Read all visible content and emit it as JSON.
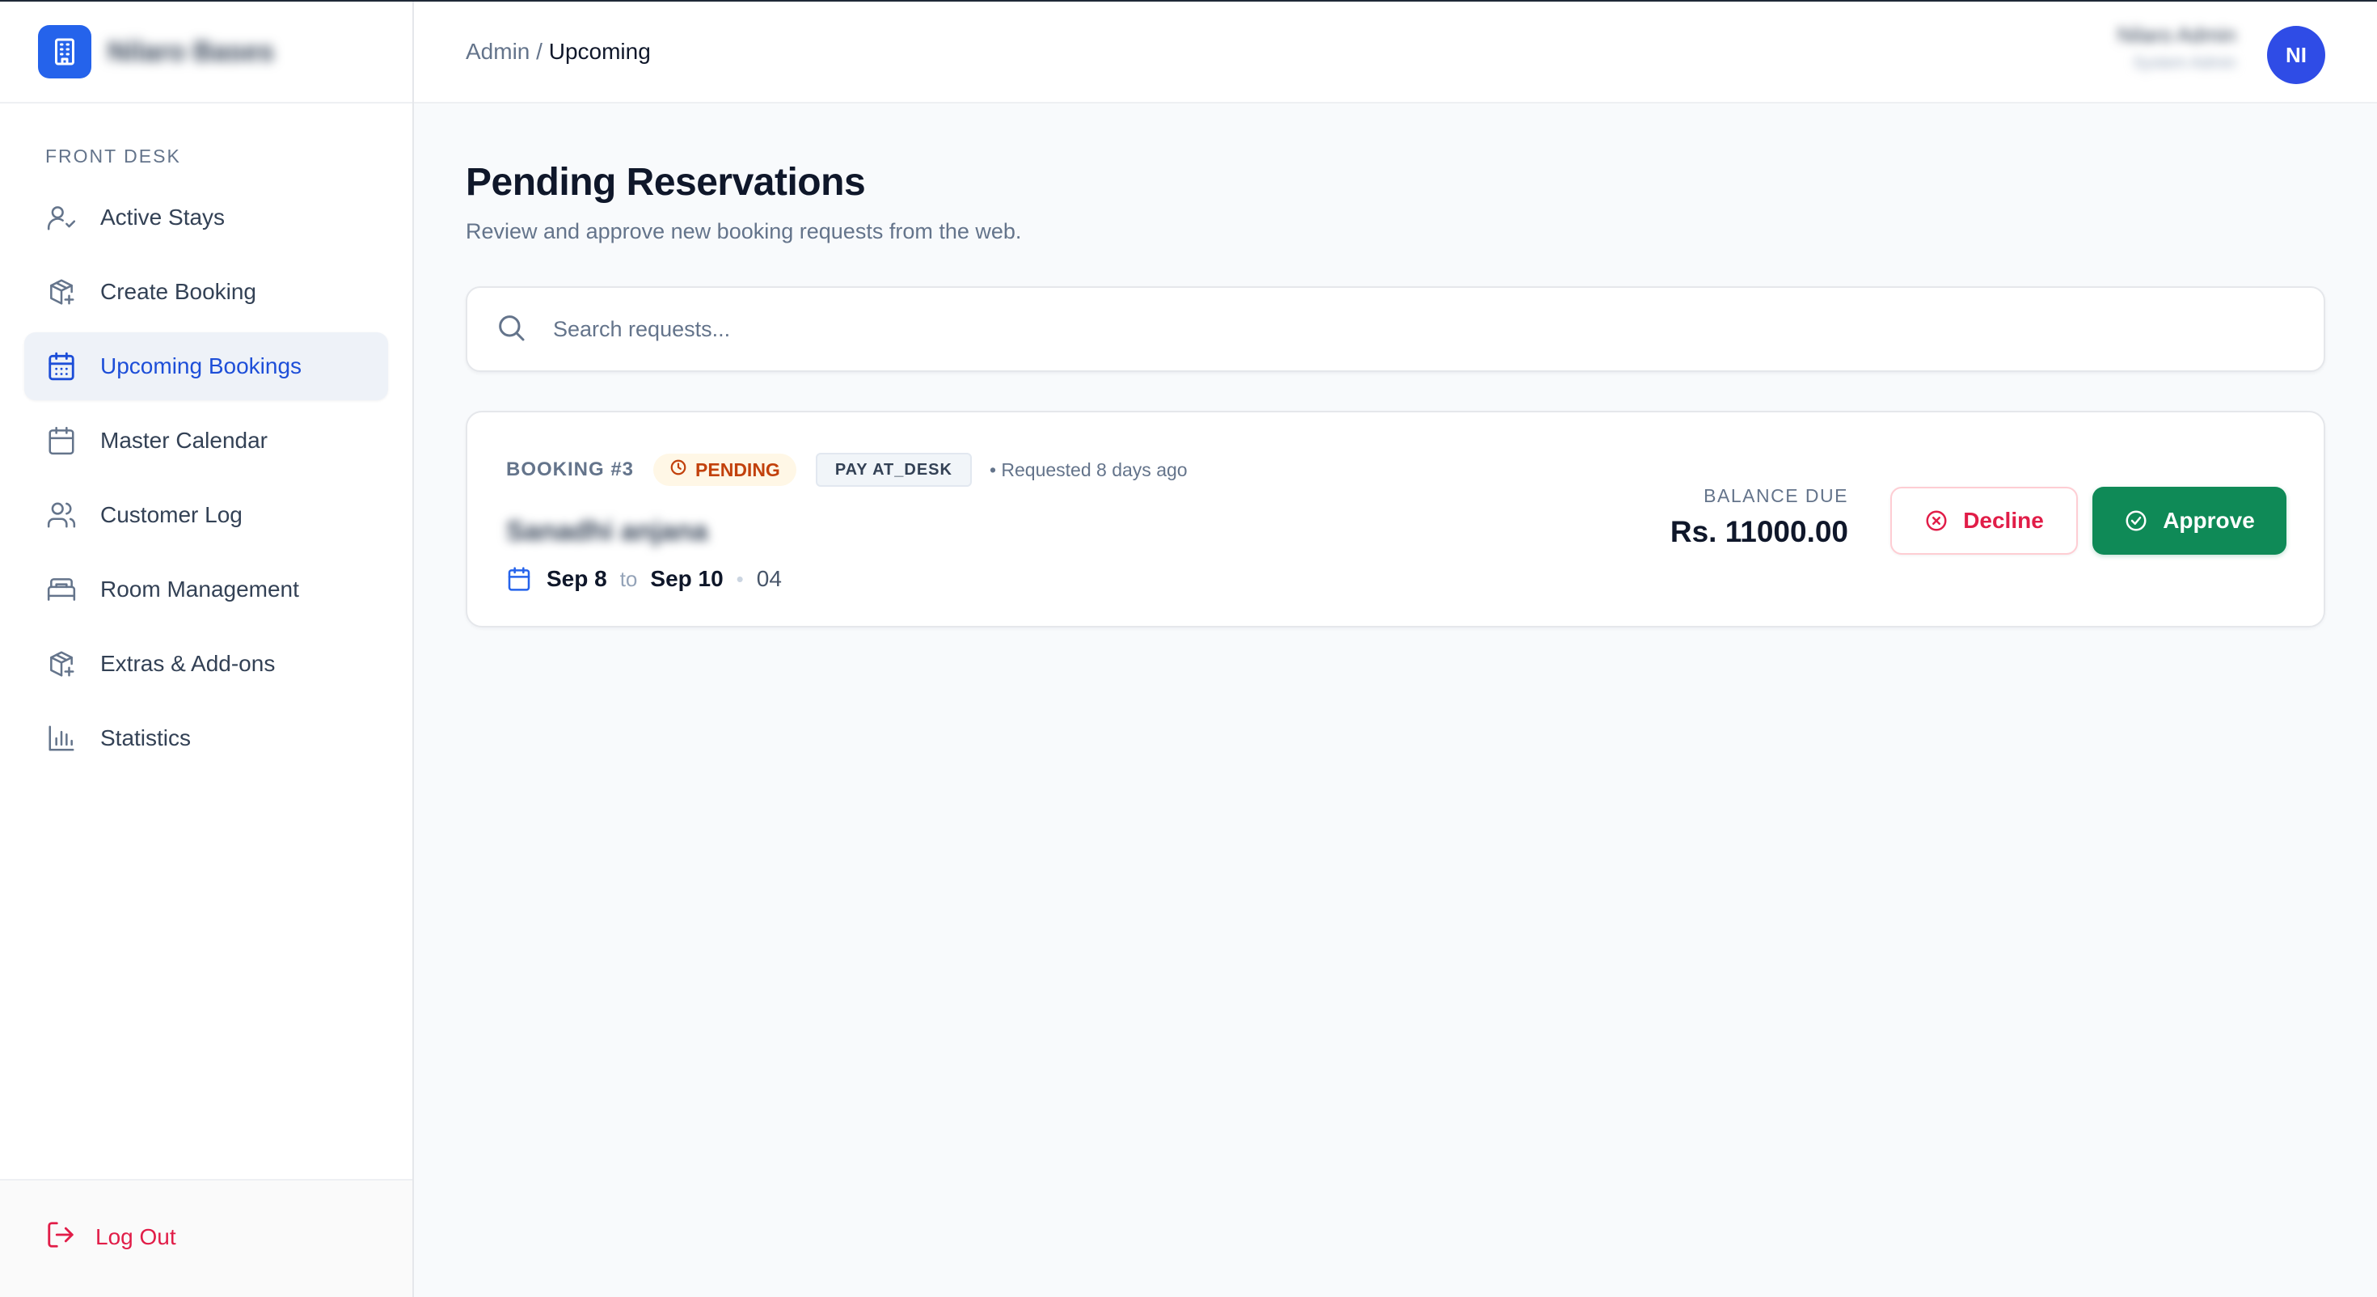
{
  "brand": {
    "name": "Nilaro Bases",
    "logo_icon": "building-icon",
    "color": "#2563eb"
  },
  "sidebar": {
    "section_label": "FRONT DESK",
    "items": [
      {
        "label": "Active Stays",
        "icon": "user-check-icon",
        "active": false
      },
      {
        "label": "Create Booking",
        "icon": "package-plus-icon",
        "active": false
      },
      {
        "label": "Upcoming Bookings",
        "icon": "calendar-days-icon",
        "active": true
      },
      {
        "label": "Master Calendar",
        "icon": "calendar-icon",
        "active": false
      },
      {
        "label": "Customer Log",
        "icon": "users-icon",
        "active": false
      },
      {
        "label": "Room Management",
        "icon": "bed-icon",
        "active": false
      },
      {
        "label": "Extras & Add-ons",
        "icon": "package-plus-icon",
        "active": false
      },
      {
        "label": "Statistics",
        "icon": "bar-chart-icon",
        "active": false
      }
    ],
    "logout_label": "Log Out"
  },
  "header": {
    "breadcrumb_root": "Admin",
    "breadcrumb_sep": "/",
    "breadcrumb_current": "Upcoming",
    "user_name": "Nilaro Admin",
    "user_role": "System Admin",
    "avatar_initials": "NI"
  },
  "main": {
    "title": "Pending Reservations",
    "subtitle": "Review and approve new booking requests from the web.",
    "search_placeholder": "Search requests...",
    "bookings": [
      {
        "id_label": "BOOKING #3",
        "status": "PENDING",
        "payment": "PAY AT_DESK",
        "requested": "• Requested 8 days ago",
        "guest_name": "Sanadhi anjana",
        "check_in": "Sep 8",
        "to_label": "to",
        "check_out": "Sep 10",
        "separator": "•",
        "room": "04",
        "balance_label": "BALANCE DUE",
        "balance_amount": "Rs. 11000.00",
        "decline_label": "Decline",
        "approve_label": "Approve"
      }
    ]
  },
  "colors": {
    "accent": "#2563eb",
    "approve": "#0f8a57",
    "decline": "#e11d48",
    "pending": "#c2410c"
  }
}
